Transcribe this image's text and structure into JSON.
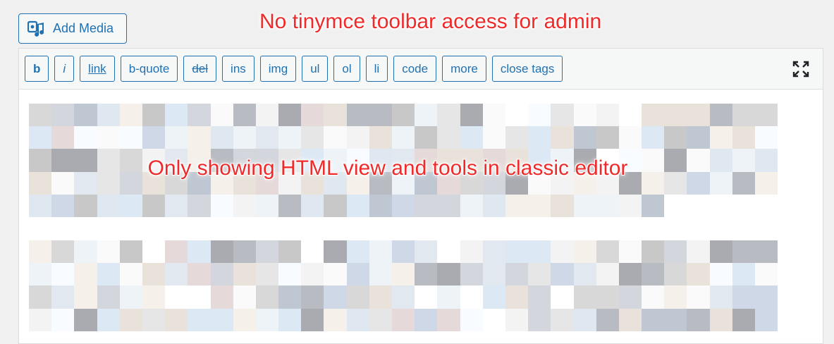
{
  "toolbar_top": {
    "add_media_label": "Add Media"
  },
  "annotations": {
    "top": "No tinymce toolbar access for admin",
    "middle": "Only showing HTML view and tools in classic editor"
  },
  "quicktags": [
    "b",
    "i",
    "link",
    "b-quote",
    "del",
    "ins",
    "img",
    "ul",
    "ol",
    "li",
    "code",
    "more",
    "close tags"
  ],
  "icons": {
    "add_media": "media-icon",
    "fullscreen": "fullscreen-expand-icon"
  },
  "colors": {
    "accent": "#2271b1",
    "annotation": "#ee2a2a"
  },
  "content": {
    "state": "pixelated/blurred text"
  }
}
